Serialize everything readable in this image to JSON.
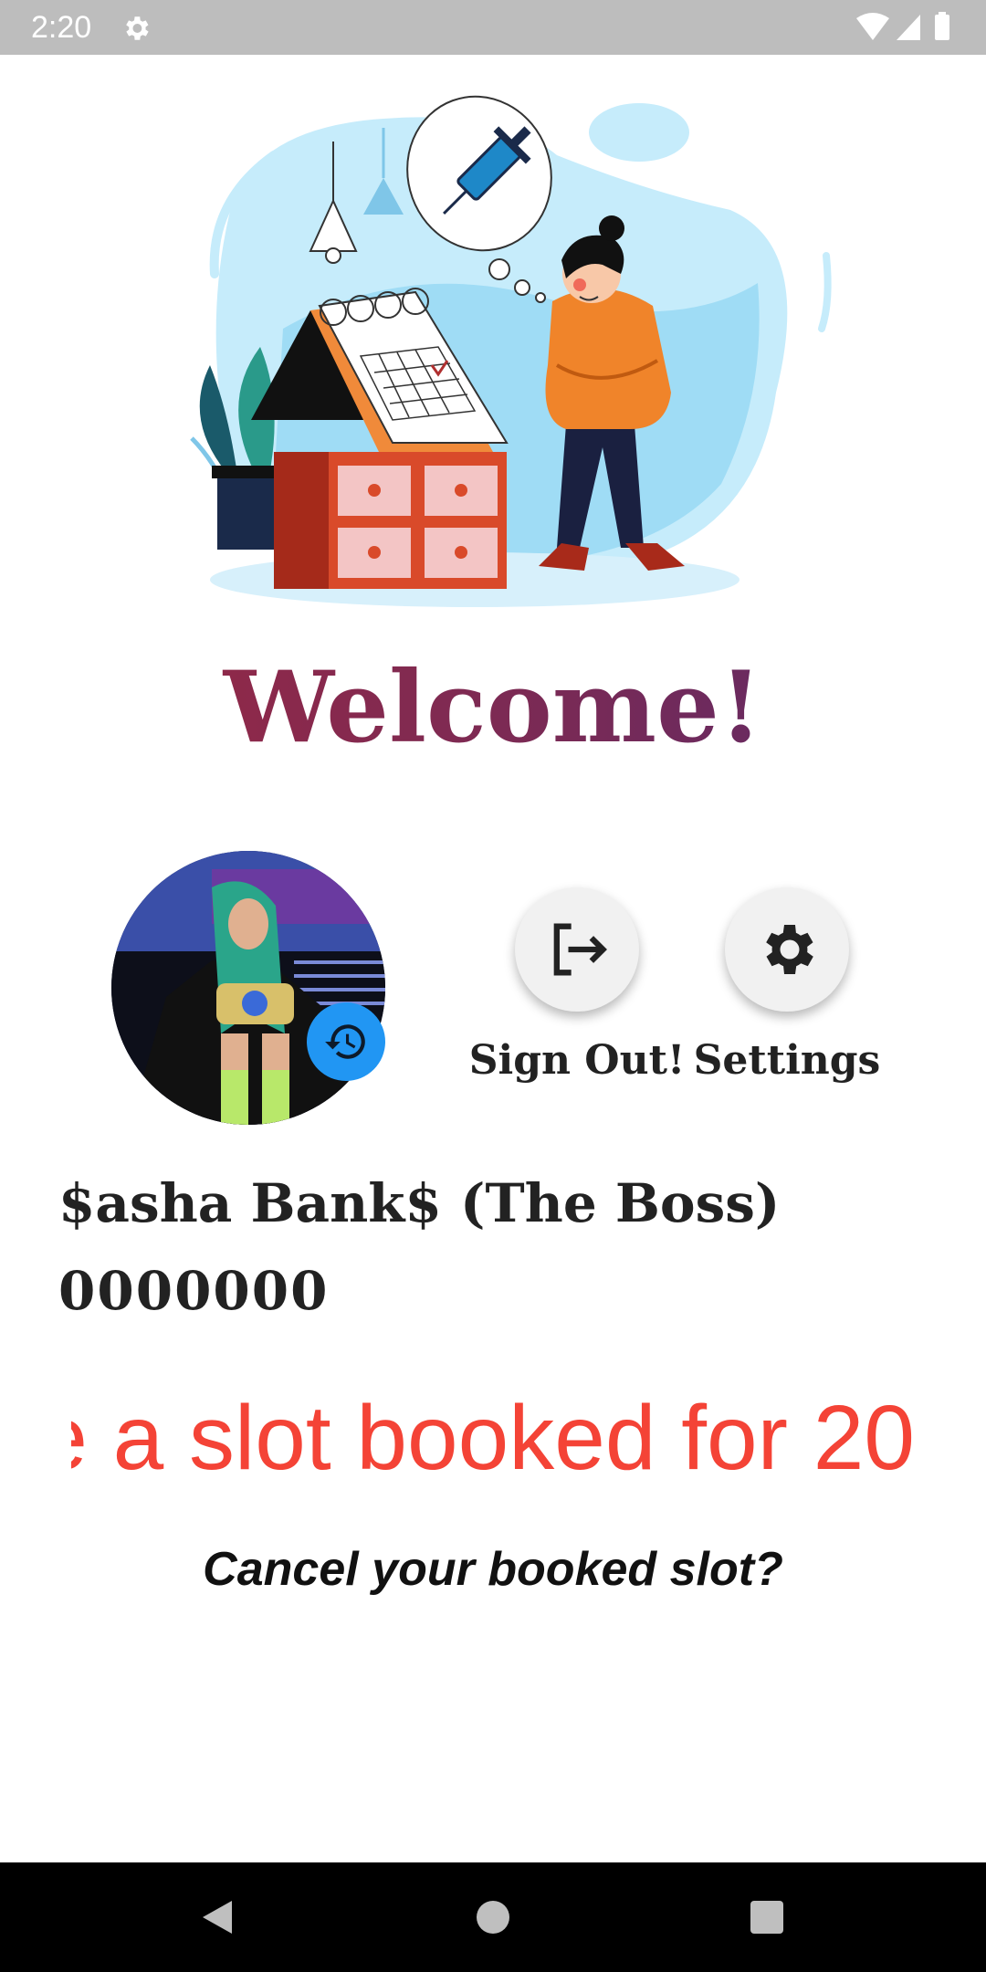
{
  "status_bar": {
    "time": "2:20"
  },
  "page": {
    "title": "Welcome!"
  },
  "actions": {
    "sign_out_label": "Sign Out!",
    "settings_label": "Settings"
  },
  "user": {
    "name": "$asha Bank$ (The Boss)",
    "phone": "0000000"
  },
  "booking": {
    "status_message": "e a slot booked for 20",
    "cancel_link": "Cancel your booked slot?"
  },
  "colors": {
    "title_gradient_start": "#9b2842",
    "title_gradient_end": "#5a2a6a",
    "status_message": "#f44336",
    "avatar_badge": "#2196f3",
    "status_bar": "#bdbdbd"
  },
  "icons": {
    "sign_out": "logout-icon",
    "settings": "gear-icon",
    "avatar_badge": "history-icon"
  }
}
